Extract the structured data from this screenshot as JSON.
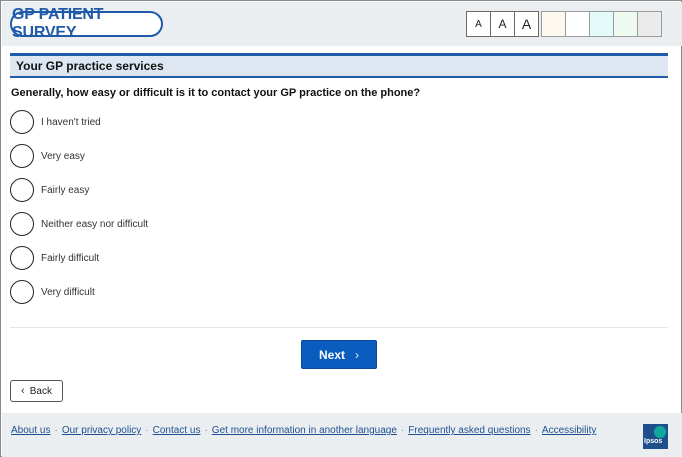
{
  "header": {
    "logo_text": "GP PATIENT SURVEY",
    "font_size_buttons": [
      "A",
      "A",
      "A"
    ],
    "color_swatches": [
      "#fdf8ee",
      "#ffffff",
      "#e4fbfb",
      "#eefaef",
      "#ebebeb"
    ]
  },
  "section": {
    "title": "Your GP practice services"
  },
  "question": {
    "text": "Generally, how easy or difficult is it to contact your GP practice on the phone?",
    "options": [
      {
        "label": "I haven't tried"
      },
      {
        "label": "Very easy"
      },
      {
        "label": "Fairly easy"
      },
      {
        "label": "Neither easy nor difficult"
      },
      {
        "label": "Fairly difficult"
      },
      {
        "label": "Very difficult"
      }
    ]
  },
  "nav": {
    "next_label": "Next",
    "back_label": "Back"
  },
  "footer": {
    "links": [
      "About us",
      "Our privacy policy",
      "Contact us",
      "Get more information in another language",
      "Frequently asked questions",
      "Accessibility"
    ],
    "logo_text": "Ipsos"
  },
  "colors": {
    "brand_blue": "#1f5ba8",
    "button_blue": "#0b5cbf",
    "header_bg": "#ebeef0",
    "section_bg": "#dde6f1"
  }
}
